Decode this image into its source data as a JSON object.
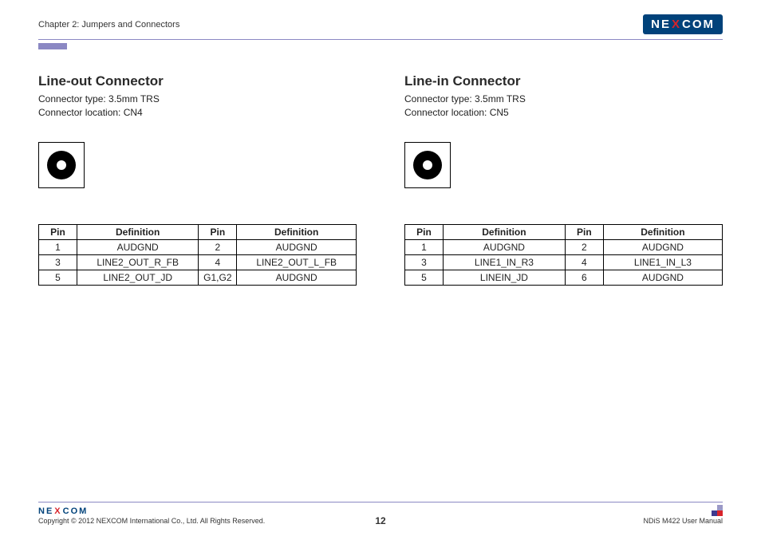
{
  "header": {
    "chapter": "Chapter 2: Jumpers and Connectors",
    "logo": {
      "pre": "NE",
      "mid": "X",
      "post": "COM"
    }
  },
  "left": {
    "title": "Line-out Connector",
    "type_line": "Connector type: 3.5mm TRS",
    "loc_line": "Connector location: CN4",
    "th_pin": "Pin",
    "th_def": "Definition",
    "rows": [
      {
        "p1": "1",
        "d1": "AUDGND",
        "p2": "2",
        "d2": "AUDGND"
      },
      {
        "p1": "3",
        "d1": "LINE2_OUT_R_FB",
        "p2": "4",
        "d2": "LINE2_OUT_L_FB"
      },
      {
        "p1": "5",
        "d1": "LINE2_OUT_JD",
        "p2": "G1,G2",
        "d2": "AUDGND"
      }
    ]
  },
  "right": {
    "title": "Line-in Connector",
    "type_line": "Connector type: 3.5mm TRS",
    "loc_line": "Connector location: CN5",
    "th_pin": "Pin",
    "th_def": "Definition",
    "rows": [
      {
        "p1": "1",
        "d1": "AUDGND",
        "p2": "2",
        "d2": "AUDGND"
      },
      {
        "p1": "3",
        "d1": "LINE1_IN_R3",
        "p2": "4",
        "d2": "LINE1_IN_L3"
      },
      {
        "p1": "5",
        "d1": "LINEIN_JD",
        "p2": "6",
        "d2": "AUDGND"
      }
    ]
  },
  "footer": {
    "copyright": "Copyright © 2012 NEXCOM International Co., Ltd. All Rights Reserved.",
    "page": "12",
    "manual": "NDiS M422 User Manual"
  }
}
